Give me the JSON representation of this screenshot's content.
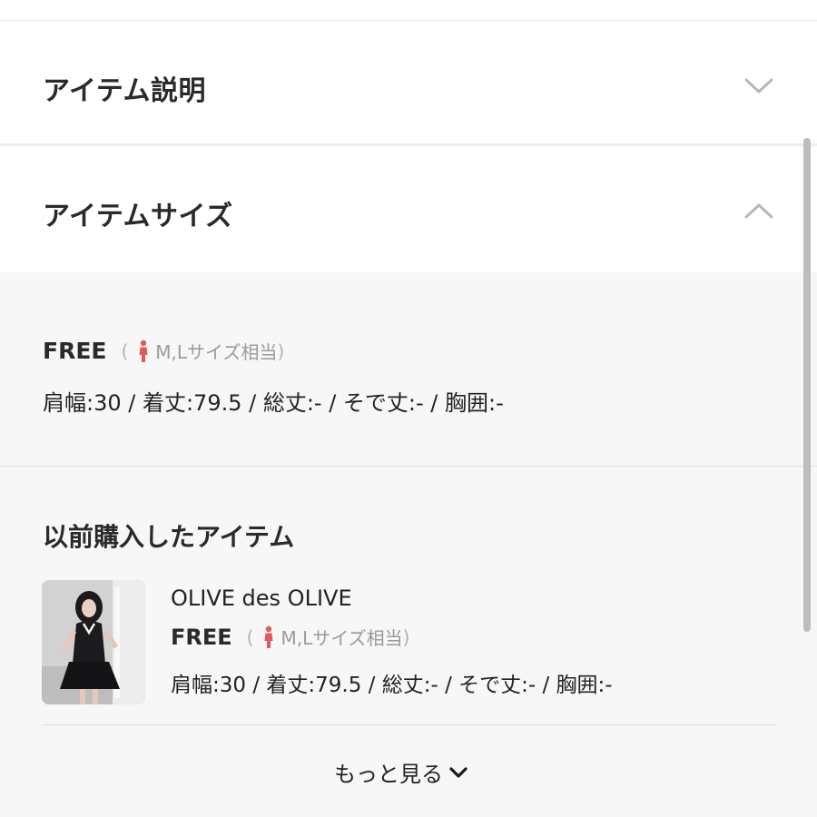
{
  "sections": {
    "item_description": {
      "title": "アイテム説明",
      "expanded": false,
      "chevron_icon": "chevron-down-icon"
    },
    "item_size": {
      "title": "アイテムサイズ",
      "expanded": true,
      "chevron_icon": "chevron-up-icon",
      "size_label": "FREE",
      "paren_open": "(",
      "equivalent_text": "M,Lサイズ相当",
      "paren_close": ")",
      "measurements": "肩幅:30 / 着丈:79.5 / 総丈:- / そで丈:- / 胸囲:-"
    }
  },
  "previous_purchases": {
    "title": "以前購入したアイテム",
    "items": [
      {
        "brand": "OLIVE des OLIVE",
        "size_label": "FREE",
        "paren_open": "(",
        "equivalent_text": "M,Lサイズ相当",
        "paren_close": ")",
        "measurements": "肩幅:30 / 着丈:79.5 / 総丈:- / そで丈:- / 胸囲:-",
        "thumbnail_icon": "product-photo"
      }
    ],
    "more_label": "もっと見る",
    "more_icon": "chevron-down-icon"
  },
  "colors": {
    "person_icon": "#e05a5a",
    "chevron": "#b8b8b8",
    "text": "#222222",
    "muted": "#9a9a9a"
  }
}
